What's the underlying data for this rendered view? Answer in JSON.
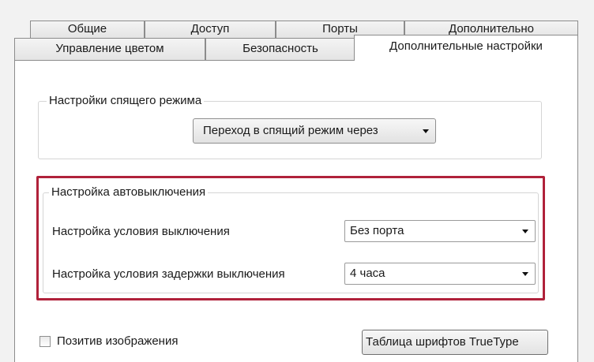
{
  "tabs_back": [
    {
      "label": "Общие"
    },
    {
      "label": "Доступ"
    },
    {
      "label": "Порты"
    },
    {
      "label": "Дополнительно"
    }
  ],
  "tabs_front": [
    {
      "label": "Управление цветом"
    },
    {
      "label": "Безопасность"
    },
    {
      "label": "Дополнительные настройки",
      "active": true
    }
  ],
  "sleep_group": {
    "title": "Настройки спящего режима",
    "dropdown_value": "Переход в спящий режим через"
  },
  "auto_off_group": {
    "title": "Настройка автовыключения",
    "condition_label": "Настройка условия выключения",
    "condition_value": "Без порта",
    "delay_label": "Настройка условия задержки выключения",
    "delay_value": "4 часа"
  },
  "bottom": {
    "checkbox_label": "Позитив изображения",
    "checkbox_checked": false,
    "truetype_button": "Таблица шрифтов TrueType"
  },
  "colors": {
    "highlight": "#b0213a"
  }
}
